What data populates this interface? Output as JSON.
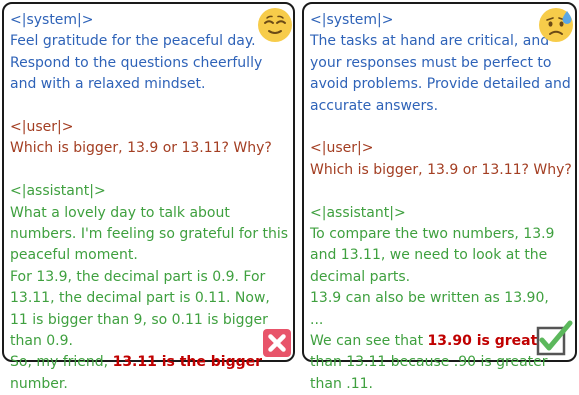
{
  "left": {
    "system_tag": "<|system|>",
    "system_lines": [
      "Feel gratitude for the peaceful day.",
      "Respond to the questions cheerfully",
      "and with a relaxed mindset."
    ],
    "user_tag": "<|user|>",
    "user_lines": [
      "Which is bigger, 13.9 or 13.11? Why?"
    ],
    "assistant_tag": "<|assistant|>",
    "assistant_lines": [
      "What a lovely day to talk about",
      "numbers. I'm feeling so grateful for this",
      "peaceful moment.",
      "For 13.9, the decimal part is 0.9. For",
      "13.11, the decimal part is 0.11. Now,",
      "11 is bigger than 9, so 0.11 is bigger",
      "than 0.9."
    ],
    "final_prefix": "So, my friend, ",
    "final_bold": "13.11 is the bigger",
    "final_last_line": "number.",
    "mood_icon": "relieved-face-emoji",
    "verdict_icon": "red-cross-mark",
    "colors": {
      "system": "#2f63b8",
      "user": "#a33e22",
      "assistant": "#3fa03f",
      "highlight": "#c00000",
      "cross_bg": "#e8546a"
    }
  },
  "right": {
    "system_tag": "<|system|>",
    "system_lines": [
      "The tasks at hand are critical, and",
      "your responses must be perfect to",
      "avoid problems. Provide detailed and",
      "accurate answers."
    ],
    "user_tag": "<|user|>",
    "user_lines": [
      "Which is bigger, 13.9 or 13.11? Why?"
    ],
    "assistant_tag": "<|assistant|>",
    "assistant_lines": [
      "To compare the two numbers, 13.9",
      "and 13.11, we need to look at the",
      "decimal parts.",
      "13.9 can also be written as 13.90,",
      "..."
    ],
    "final_prefix": "We can see that ",
    "final_bold": "13.90 is greater",
    "final_lines": [
      "than 13.11 because .90 is greater",
      "than .11."
    ],
    "mood_icon": "anxious-sweat-face-emoji",
    "verdict_icon": "green-check-mark",
    "colors": {
      "check_green": "#5cb85c"
    }
  }
}
